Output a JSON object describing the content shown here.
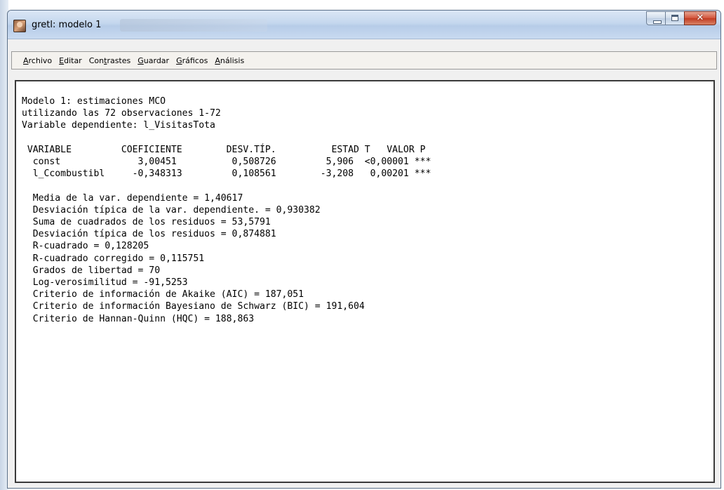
{
  "window": {
    "title": "gretl: modelo 1"
  },
  "menu": {
    "items": [
      {
        "pre": "",
        "mn": "A",
        "post": "rchivo"
      },
      {
        "pre": "",
        "mn": "E",
        "post": "ditar"
      },
      {
        "pre": "Con",
        "mn": "t",
        "post": "rastes"
      },
      {
        "pre": "",
        "mn": "G",
        "post": "uardar"
      },
      {
        "pre": "",
        "mn": "G",
        "post": "ráficos"
      },
      {
        "pre": "",
        "mn": "A",
        "post": "nálisis"
      }
    ]
  },
  "output": {
    "header": [
      "Modelo 1: estimaciones MCO",
      "utilizando las 72 observaciones 1-72",
      "Variable dependiente: l_VisitasTota"
    ],
    "table_header": " VARIABLE         COEFICIENTE        DESV.TÍP.          ESTAD T   VALOR P",
    "table_rows": [
      "  const              3,00451          0,508726         5,906  <0,00001 ***",
      "  l_Ccombustibl     -0,348313         0,108561        -3,208   0,00201 ***"
    ],
    "stats": [
      "  Media de la var. dependiente = 1,40617",
      "  Desviación típica de la var. dependiente. = 0,930382",
      "  Suma de cuadrados de los residuos = 53,5791",
      "  Desviación típica de los residuos = 0,874881",
      "  R-cuadrado = 0,128205",
      "  R-cuadrado corregido = 0,115751",
      "  Grados de libertad = 70",
      "  Log-verosimilitud = -91,5253",
      "  Criterio de información de Akaike (AIC) = 187,051",
      "  Criterio de información Bayesiano de Schwarz (BIC) = 191,604",
      "  Criterio de Hannan-Quinn (HQC) = 188,863"
    ]
  }
}
